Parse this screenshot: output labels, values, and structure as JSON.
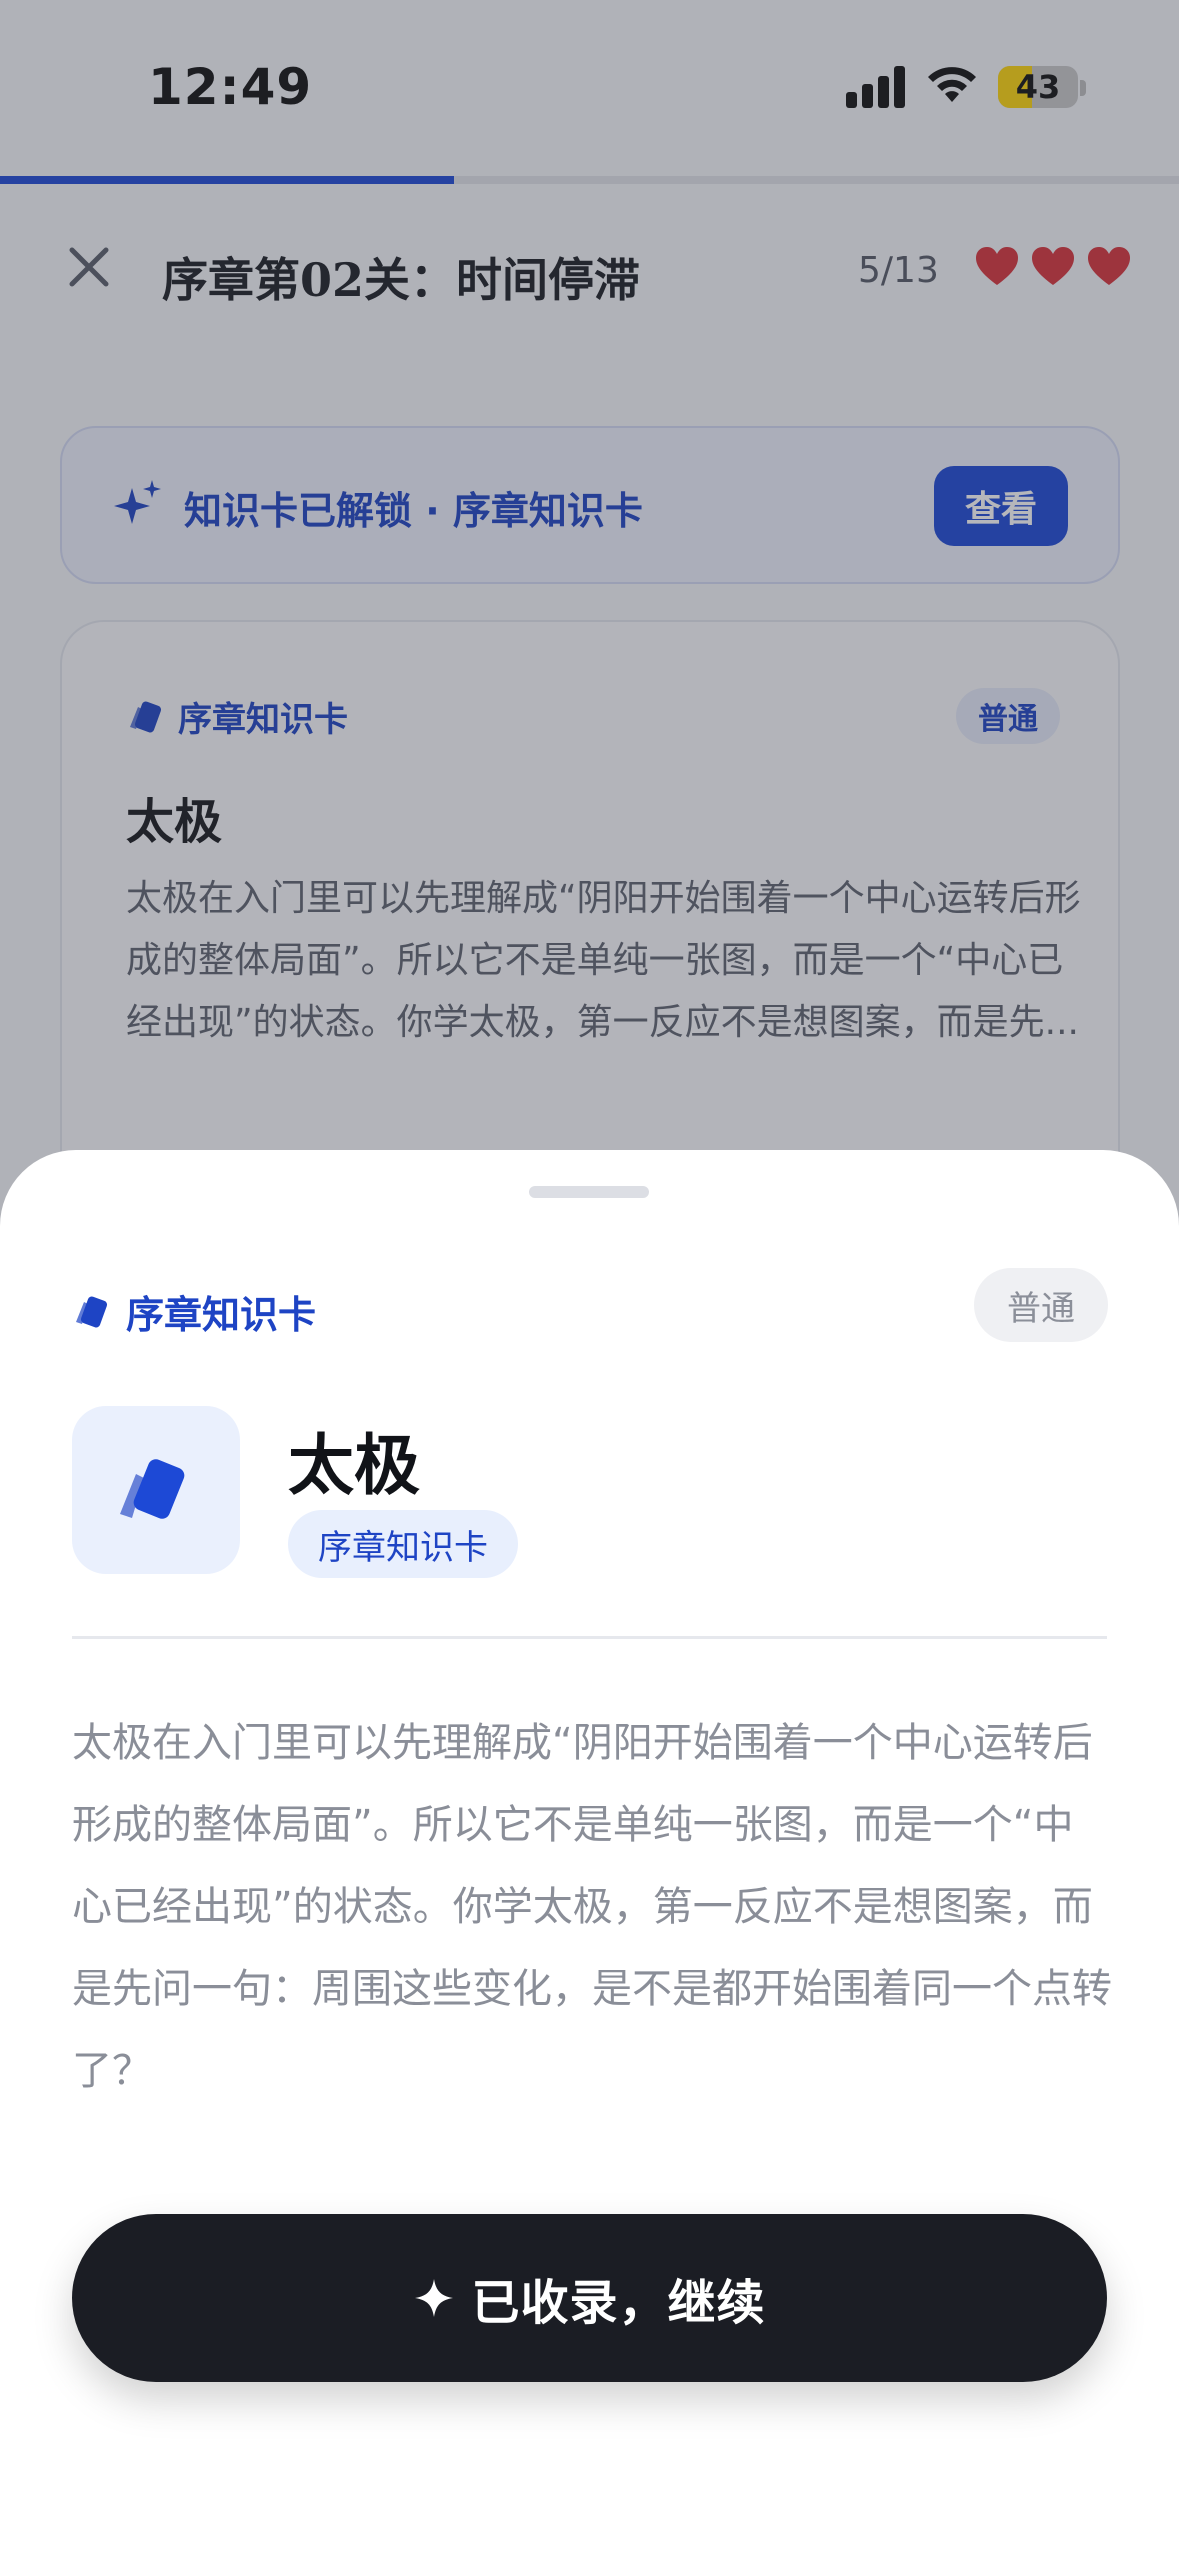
{
  "status_bar": {
    "time": "12:49",
    "battery_level": "43",
    "battery_fraction": 0.43
  },
  "progress": {
    "fraction": 0.385,
    "color": "#1d49d6"
  },
  "header": {
    "title": "序章第02关：时间停滞",
    "count": "5/13",
    "hearts": 3,
    "close_icon": "close-icon",
    "heart_color": "#d8323a"
  },
  "unlock_banner": {
    "text": "知识卡已解锁 · 序章知识卡",
    "button_label": "查看",
    "icon": "sparkle-icon"
  },
  "background_card": {
    "tag": "序章知识卡",
    "badge": "普通",
    "title": "太极",
    "excerpt": "太极在入门里可以先理解成“阴阳开始围着一个中心运转后形成的整体局面”。所以它不是单纯一张图，而是一个“中心已经出现”的状态。你学太极，第一反应不是想图案，而是先..."
  },
  "sheet": {
    "tag": "序章知识卡",
    "badge": "普通",
    "title": "太极",
    "chip": "序章知识卡",
    "body": "太极在入门里可以先理解成“阴阳开始围着一个中心运转后形成的整体局面”。所以它不是单纯一张图，而是一个“中心已经出现”的状态。你学太极，第一反应不是想图案，而是先问一句：周围这些变化，是不是都开始围着同一个点转了？",
    "card_icon": "cards-icon",
    "accent": "#1e44c4"
  },
  "continue_button": {
    "label": "已收录，继续",
    "icon": "sparkle-icon",
    "color": "#1b1d24"
  }
}
